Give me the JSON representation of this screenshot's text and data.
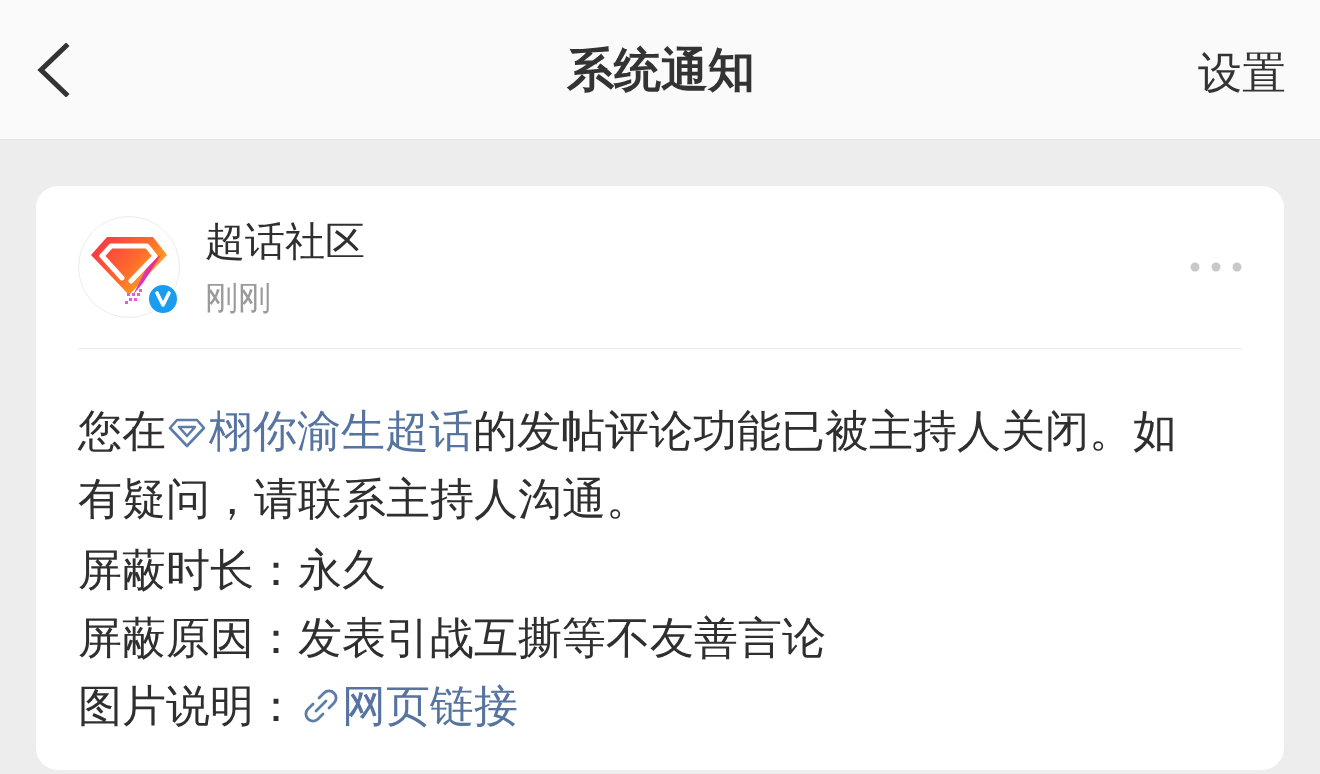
{
  "header": {
    "title": "系统通知",
    "action": "设置"
  },
  "notification": {
    "sender": "超话社区",
    "verified": true,
    "time": "刚刚",
    "message": [
      {
        "kind": "text",
        "text": "您在"
      },
      {
        "kind": "topic",
        "text": "栩你渝生超话"
      },
      {
        "kind": "text",
        "text": "的发帖评论功能已被主持人关闭。如有疑问，请联系主持人沟通。"
      }
    ],
    "fields": [
      {
        "kind": "text",
        "label": "屏蔽时长：",
        "value": "永久"
      },
      {
        "kind": "text",
        "label": "屏蔽原因：",
        "value": "发表引战互撕等不友善言论"
      },
      {
        "kind": "link",
        "label": "图片说明：",
        "value": "网页链接"
      }
    ]
  }
}
